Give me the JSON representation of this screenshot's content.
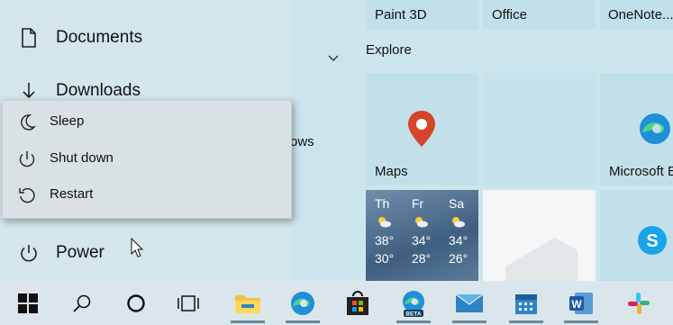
{
  "left_column": {
    "items": [
      {
        "label": "Documents",
        "icon": "document-icon"
      },
      {
        "label": "Downloads",
        "icon": "download-icon"
      },
      {
        "label": "Power",
        "icon": "power-icon"
      }
    ]
  },
  "middle": {
    "clipped_text": "ows"
  },
  "tiles": {
    "top_row": [
      "Paint 3D",
      "Office",
      "OneNote..."
    ],
    "group_title": "Explore",
    "maps_label": "Maps",
    "edge_label": "Microsoft E",
    "weather": {
      "days": [
        {
          "day": "Th",
          "high": "38°",
          "low": "30°"
        },
        {
          "day": "Fr",
          "high": "34°",
          "low": "28°"
        },
        {
          "day": "Sa",
          "high": "34°",
          "low": "26°"
        }
      ]
    }
  },
  "power_menu": {
    "items": [
      {
        "label": "Sleep",
        "icon": "moon-icon"
      },
      {
        "label": "Shut down",
        "icon": "power-icon"
      },
      {
        "label": "Restart",
        "icon": "restart-icon"
      }
    ]
  },
  "taskbar": {
    "items": [
      {
        "name": "start",
        "icon": "windows-logo-icon"
      },
      {
        "name": "search",
        "icon": "search-icon"
      },
      {
        "name": "cortana",
        "icon": "cortana-circle-icon"
      },
      {
        "name": "task-view",
        "icon": "task-view-icon"
      },
      {
        "name": "file-explorer",
        "icon": "folder-icon"
      },
      {
        "name": "edge",
        "icon": "edge-icon"
      },
      {
        "name": "store",
        "icon": "store-icon"
      },
      {
        "name": "edge-beta",
        "icon": "edge-beta-icon",
        "badge": "BETA"
      },
      {
        "name": "mail",
        "icon": "mail-icon"
      },
      {
        "name": "calendar",
        "icon": "calendar-icon"
      },
      {
        "name": "word",
        "icon": "word-icon",
        "letter": "W"
      },
      {
        "name": "slack",
        "icon": "slack-icon"
      }
    ]
  },
  "colors": {
    "accent": "#0078d4",
    "maps_pin": "#d6452a"
  }
}
